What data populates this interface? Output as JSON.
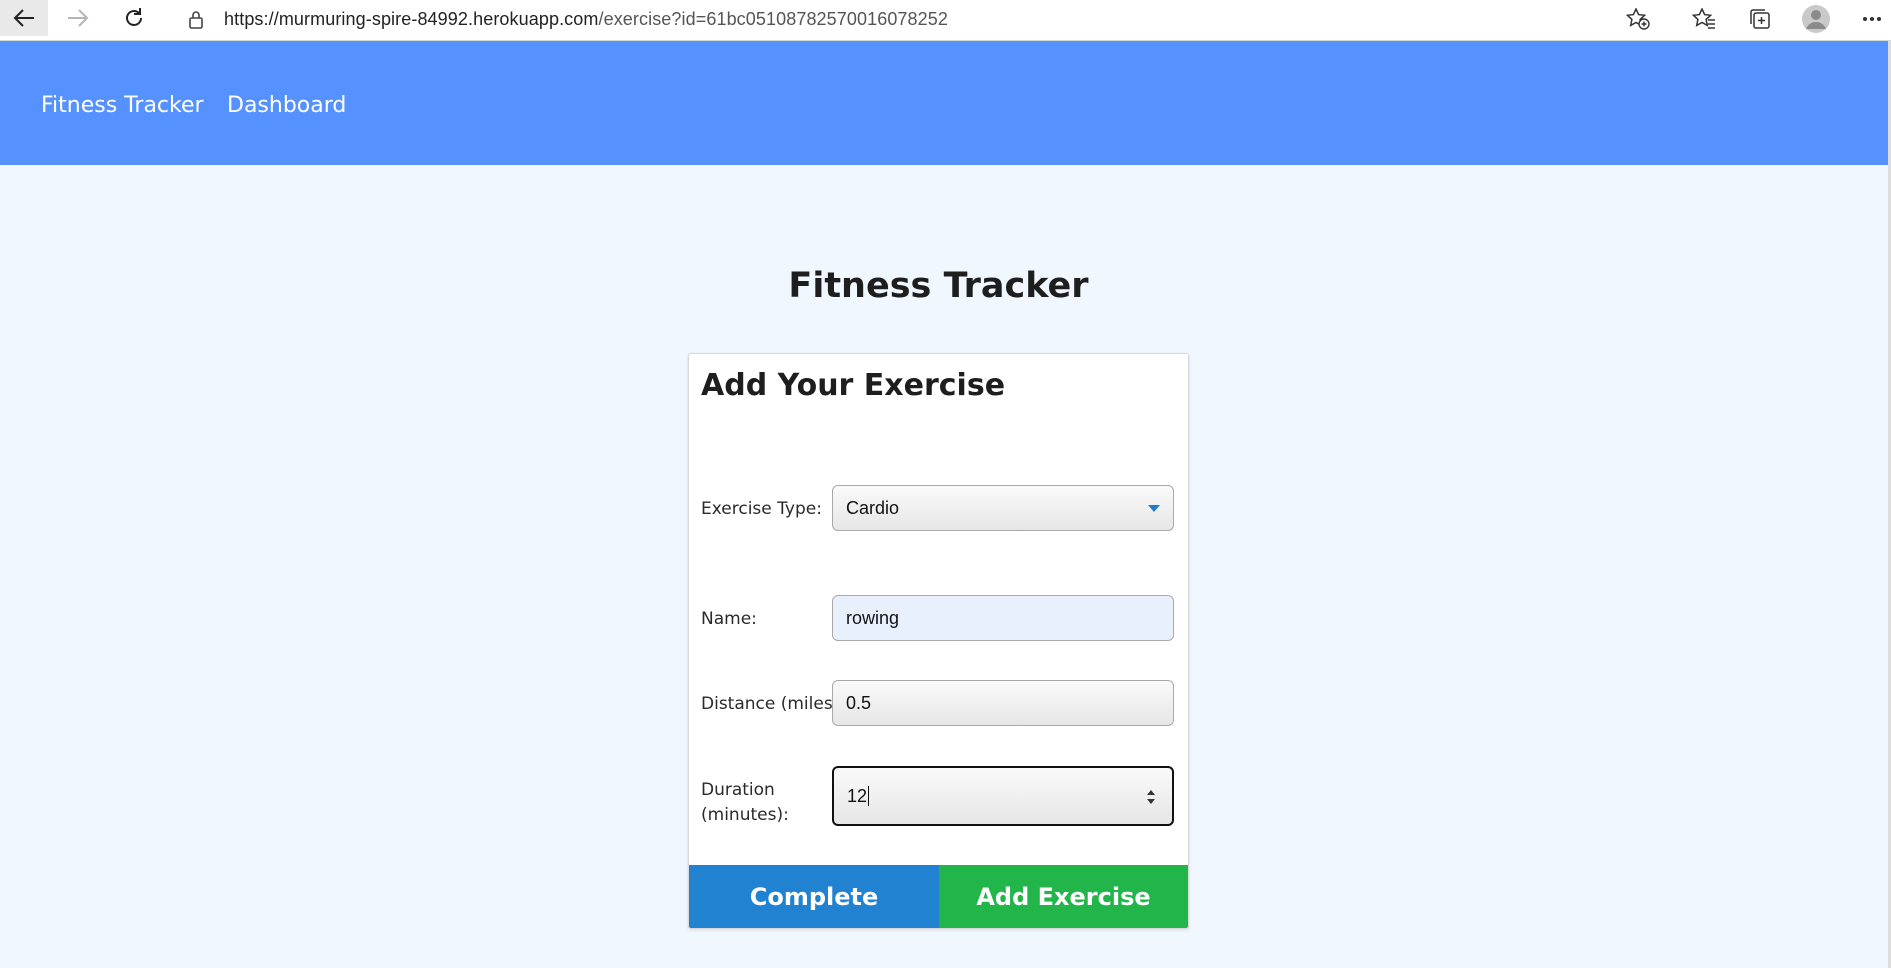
{
  "browser": {
    "url_host": "https://murmuring-spire-84992.herokuapp.com",
    "url_path": "/exercise?id=61bc05108782570016078252",
    "icons": [
      "back-arrow-icon",
      "forward-arrow-icon",
      "reload-icon",
      "lock-icon",
      "add-favorite-icon",
      "favorites-icon",
      "collections-icon",
      "profile-icon",
      "more-icon"
    ]
  },
  "nav": {
    "brand": "Fitness Tracker",
    "dashboard": "Dashboard",
    "color": "#5692ff"
  },
  "page": {
    "title": "Fitness Tracker"
  },
  "form": {
    "heading": "Add Your Exercise",
    "exercise_type_label": "Exercise Type:",
    "exercise_type_value": "Cardio",
    "name_label": "Name:",
    "name_value": "rowing",
    "distance_label": "Distance (miles):",
    "distance_value": "0.5",
    "duration_label_line1": "Duration",
    "duration_label_line2": "(minutes):",
    "duration_value": "12",
    "complete_label": "Complete",
    "add_label": "Add Exercise",
    "complete_color": "#2182d2",
    "add_color": "#22b64a"
  }
}
